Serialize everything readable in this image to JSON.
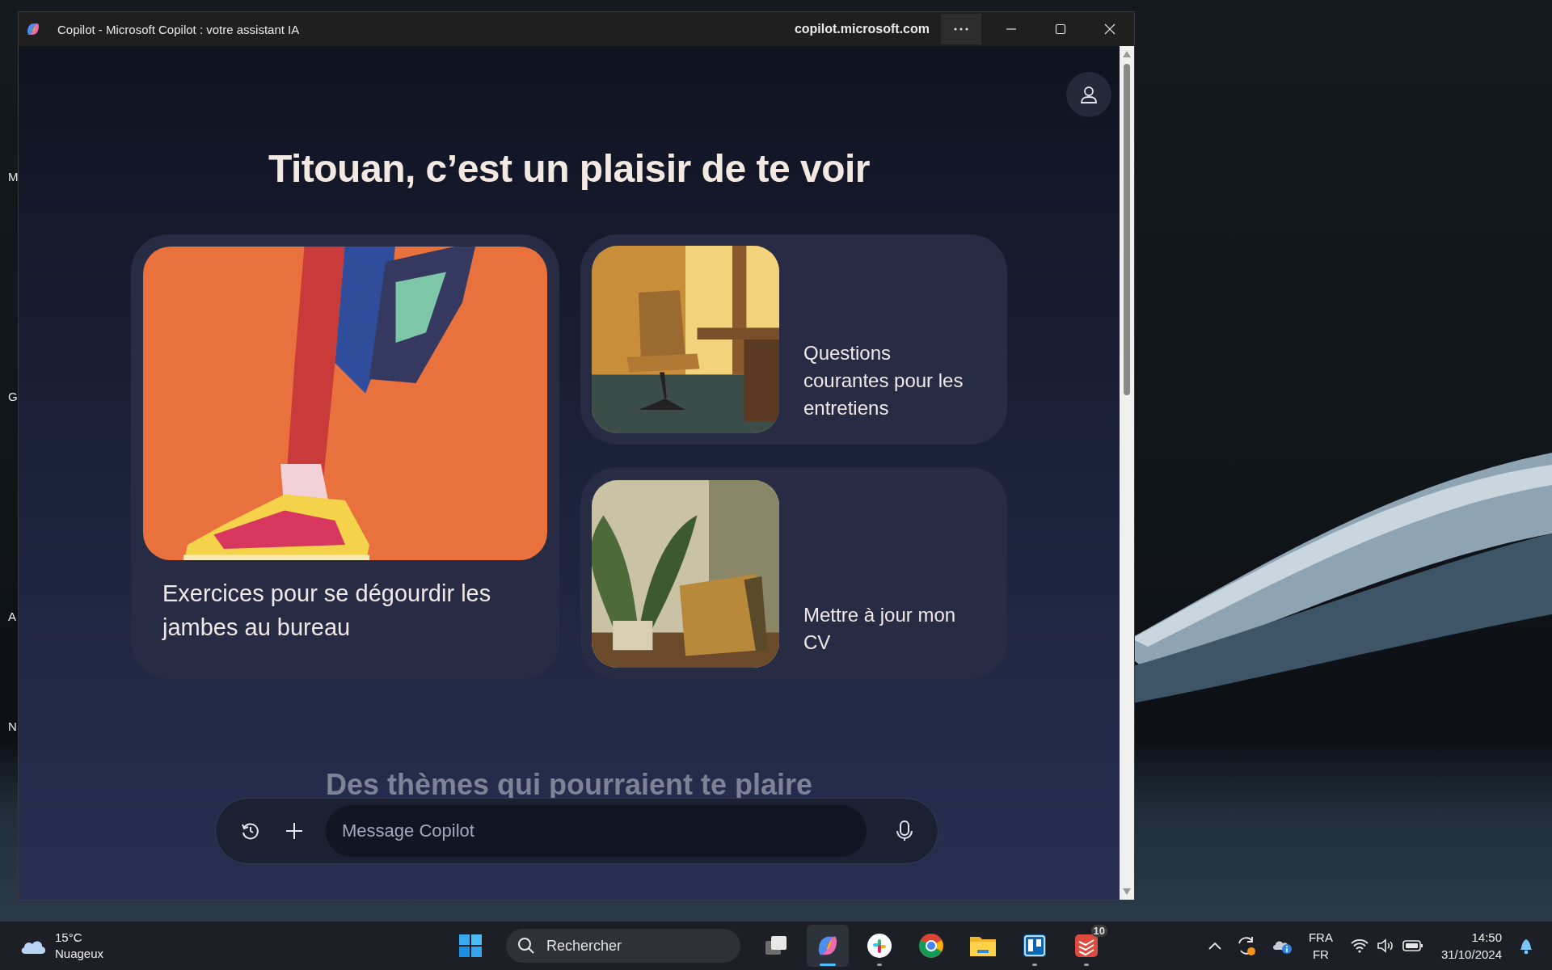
{
  "desktop_labels": [
    "M",
    "G",
    "A",
    "N"
  ],
  "window": {
    "title": "Copilot - Microsoft Copilot : votre assistant IA",
    "url": "copilot.microsoft.com"
  },
  "page": {
    "greeting": "Titouan, c’est un plaisir de te voir",
    "cards": [
      {
        "kind": "large",
        "title": "Exercices pour se dégourdir les jambes au bureau"
      },
      {
        "kind": "small",
        "title": "Questions courantes pour les entretiens"
      },
      {
        "kind": "small",
        "title": "Mettre à jour mon CV"
      }
    ],
    "section_heading": "Des thèmes qui pourraient te plaire",
    "composer": {
      "placeholder": "Message Copilot"
    }
  },
  "taskbar": {
    "weather": {
      "temperature": "15°C",
      "condition": "Nuageux"
    },
    "search": {
      "placeholder": "Rechercher"
    },
    "apps": [
      {
        "kind": "taskview",
        "running": false,
        "selected": false
      },
      {
        "kind": "copilot",
        "running": true,
        "selected": true
      },
      {
        "kind": "slack",
        "running": true,
        "selected": false
      },
      {
        "kind": "chrome",
        "running": false,
        "selected": false
      },
      {
        "kind": "explorer",
        "running": false,
        "selected": false
      },
      {
        "kind": "trello",
        "running": true,
        "selected": false
      },
      {
        "kind": "todoist",
        "running": true,
        "selected": false,
        "badge": "10"
      }
    ],
    "language": {
      "input": "FRA",
      "layout": "FR"
    },
    "clock": {
      "time": "14:50",
      "date": "31/10/2024"
    }
  }
}
